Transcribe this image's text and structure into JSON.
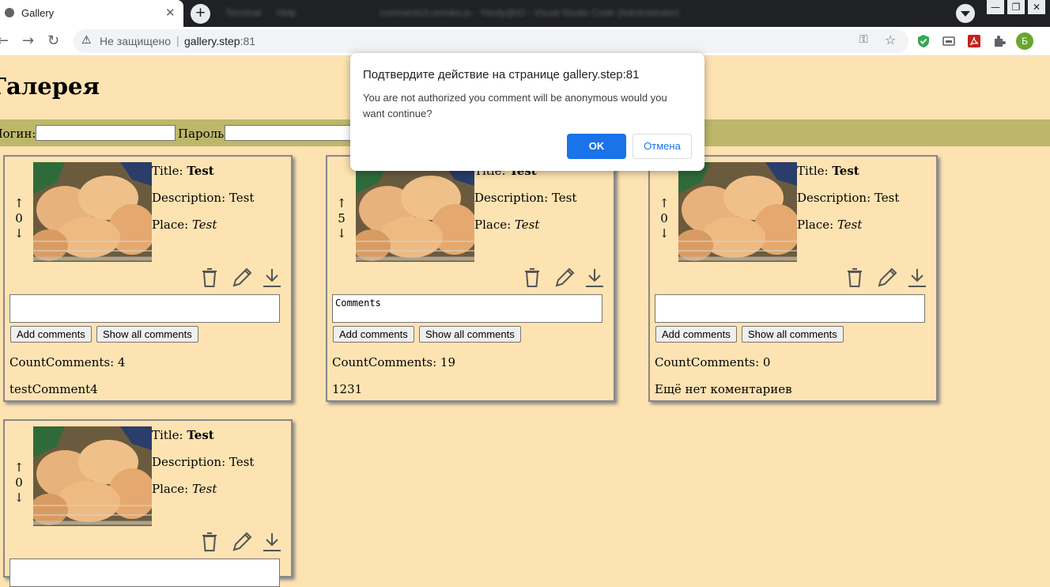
{
  "browser": {
    "tab_title": "Gallery",
    "tab_close": "✕",
    "new_tab": "+",
    "other_window_texts": [
      "Terminal",
      "Help",
      "comments3.omniko.js - Yandy@IO - Visual Studio Code (Administrator)"
    ],
    "security_label": "Не защищено",
    "url_host": "gallery.step",
    "url_port": ":81",
    "profile_initial": "Б",
    "window_controls": [
      "—",
      "❐",
      "✕"
    ]
  },
  "page": {
    "heading": "Галерея",
    "login_label": "Логин:",
    "password_label": "Пароль:"
  },
  "labels": {
    "title": "Title:",
    "description": "Description:",
    "place": "Place:",
    "add_comments": "Add comments",
    "show_all_comments": "Show all comments",
    "count_comments": "CountComments:",
    "up": "↑",
    "down": "↓"
  },
  "cards": [
    {
      "votes": "0",
      "title": "Test",
      "description": "Test",
      "place": "Test",
      "comment_text": "",
      "count": "4",
      "last_comment": "testComment4"
    },
    {
      "votes": "5",
      "title": "Test",
      "description": "Test",
      "place": "Test",
      "comment_text": "Comments",
      "count": "19",
      "last_comment": "1231"
    },
    {
      "votes": "0",
      "title": "Test",
      "description": "Test",
      "place": "Test",
      "comment_text": "",
      "count": "0",
      "last_comment": "Ещё нет коментариев"
    },
    {
      "votes": "0",
      "title": "Test",
      "description": "Test",
      "place": "Test",
      "comment_text": "",
      "count": "",
      "last_comment": ""
    }
  ],
  "dialog": {
    "title": "Подтвердите действие на странице gallery.step:81",
    "message": "You are not authorized you comment will be anonymous would you want continue?",
    "ok_label": "OK",
    "cancel_label": "Отмена"
  },
  "colors": {
    "page_bg": "#fee3b2",
    "login_bar": "#bdb76b",
    "dialog_ok": "#1a73e8"
  }
}
